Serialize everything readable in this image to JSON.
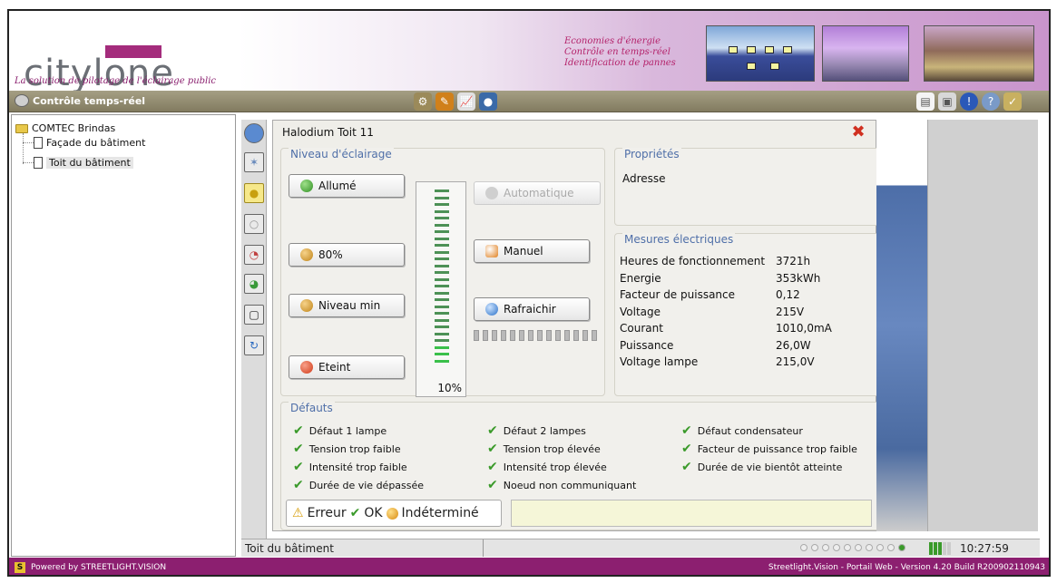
{
  "header": {
    "logo_text": "citylone",
    "tagline": "La solution de pilotage de l'éclairage public",
    "slogans": [
      "Economies d'énergie",
      "Contrôle en temps-réel",
      "Identification de pannes"
    ]
  },
  "toolbar": {
    "title": "Contrôle temps-réel"
  },
  "tree": {
    "root": "COMTEC Brindas",
    "children": [
      "Façade du bâtiment",
      "Toit du bâtiment"
    ]
  },
  "dialog": {
    "title": "Halodium Toit 11",
    "lighting_group": {
      "title": "Niveau d'éclairage",
      "buttons": {
        "on": "Allumé",
        "p80": "80%",
        "min": "Niveau min",
        "off": "Eteint",
        "auto": "Automatique",
        "manual": "Manuel",
        "refresh": "Rafraichir"
      },
      "gauge_percent": "10%",
      "gauge_level": 0.1
    },
    "properties": {
      "title": "Propriétés",
      "address_label": "Adresse"
    },
    "measures": {
      "title": "Mesures électriques",
      "rows": [
        {
          "label": "Heures de fonctionnement",
          "value": "3721h"
        },
        {
          "label": "Energie",
          "value": "353kWh"
        },
        {
          "label": "Facteur de puissance",
          "value": "0,12"
        },
        {
          "label": "Voltage",
          "value": "215V"
        },
        {
          "label": "Courant",
          "value": "1010,0mA"
        },
        {
          "label": "Puissance",
          "value": "26,0W"
        },
        {
          "label": "Voltage lampe",
          "value": "215,0V"
        }
      ]
    },
    "defaults": {
      "title": "Défauts",
      "items": [
        "Défaut 1 lampe",
        "Défaut 2 lampes",
        "Défaut condensateur",
        "Tension trop faible",
        "Tension trop élevée",
        "Facteur de puissance trop faible",
        "Intensité trop faible",
        "Intensité trop élevée",
        "Durée de vie bientôt atteinte",
        "Durée de vie dépassée",
        "Noeud non communiquant"
      ]
    },
    "legend": {
      "error": "Erreur",
      "ok": "OK",
      "undetermined": "Indéterminé"
    }
  },
  "statusbar": {
    "path": "Toit du bâtiment",
    "time": "10:27:59"
  },
  "footer": {
    "left": "Powered by STREETLIGHT.VISION",
    "right": "Streetlight.Vision - Portail Web - Version 4.20 Build R200902110943"
  },
  "colors": {
    "brand_purple": "#8c1f70",
    "toolbar": "#827b60",
    "ok_green": "#3a9a2a",
    "group_title_blue": "#4f6fa8"
  }
}
